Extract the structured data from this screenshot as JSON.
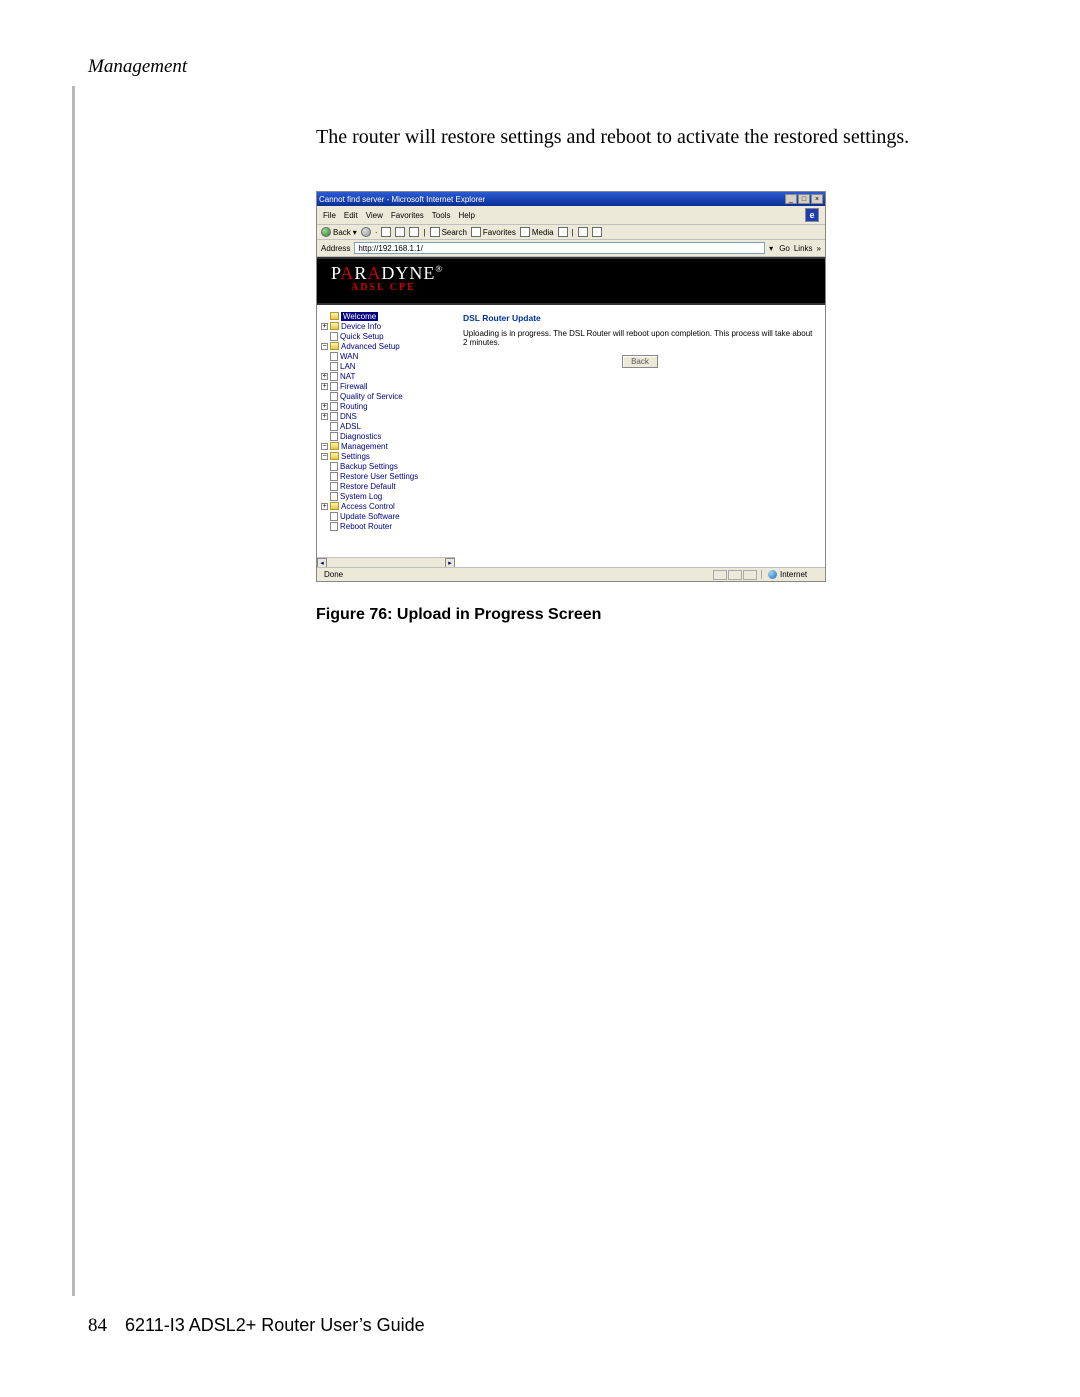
{
  "header": {
    "section_title": "Management"
  },
  "body": {
    "intro_text": "The router will restore settings and reboot to activate the restored settings."
  },
  "browser": {
    "window_title": "Cannot find server - Microsoft Internet Explorer",
    "menu": [
      "File",
      "Edit",
      "View",
      "Favorites",
      "Tools",
      "Help"
    ],
    "toolbar": {
      "back_label": "Back",
      "search_label": "Search",
      "favorites_label": "Favorites",
      "media_label": "Media"
    },
    "address": {
      "label": "Address",
      "value": "http://192.168.1.1/",
      "go_label": "Go",
      "links_label": "Links"
    },
    "status": {
      "done_label": "Done",
      "zone_label": "Internet"
    }
  },
  "router_page": {
    "brand_main": "PARADYNE",
    "brand_sub": "ADSL CPE",
    "tree": {
      "welcome": "Welcome",
      "device_info": "Device Info",
      "quick_setup": "Quick Setup",
      "advanced_setup": "Advanced Setup",
      "wan": "WAN",
      "lan": "LAN",
      "nat": "NAT",
      "firewall": "Firewall",
      "qos": "Quality of Service",
      "routing": "Routing",
      "dns": "DNS",
      "adsl": "ADSL",
      "diagnostics": "Diagnostics",
      "management": "Management",
      "settings": "Settings",
      "backup_settings": "Backup Settings",
      "restore_user_settings": "Restore User Settings",
      "restore_default": "Restore Default",
      "system_log": "System Log",
      "access_control": "Access Control",
      "update_software": "Update Software",
      "reboot_router": "Reboot Router"
    },
    "content": {
      "title": "DSL Router Update",
      "text": "Uploading is in progress. The DSL Router will reboot upon completion. This process will take about 2 minutes.",
      "button_label": "Back"
    }
  },
  "figure": {
    "caption": "Figure 76: Upload in Progress Screen"
  },
  "footer": {
    "page_number": "84",
    "doc_title": "6211-I3 ADSL2+ Router User’s Guide"
  }
}
